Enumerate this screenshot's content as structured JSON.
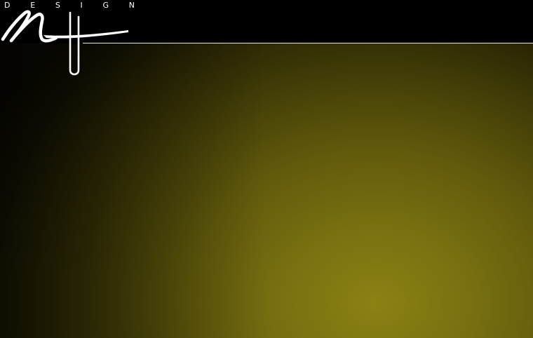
{
  "brand": {
    "wordmark": [
      "D",
      "E",
      "S",
      "I",
      "G",
      "N"
    ],
    "logo_icon": "nt-script-logo-icon"
  },
  "colors": {
    "background": "#000000",
    "glow_center": "#8b8114",
    "glow_edge": "#0a0901",
    "header_rule": "#e8e8e8"
  }
}
